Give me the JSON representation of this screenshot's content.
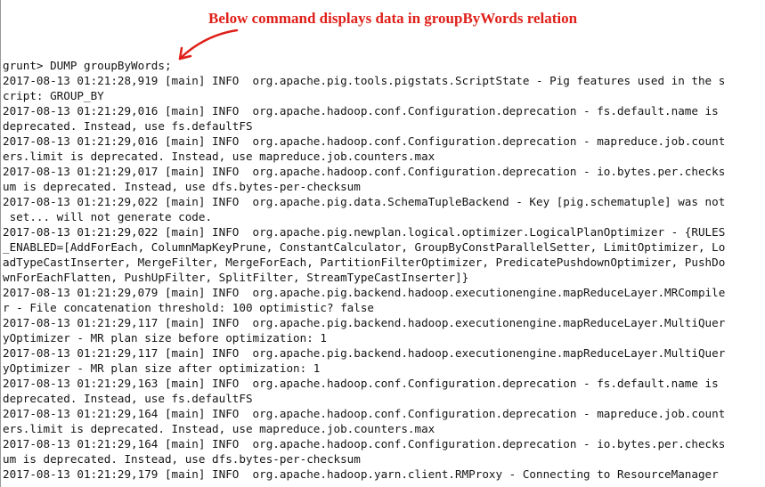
{
  "annotation": {
    "text": "Below command displays data in groupByWords relation",
    "color": "#e0201a",
    "arrow_icon": "curved-arrow-icon"
  },
  "terminal": {
    "lines": [
      "grunt> DUMP groupByWords;",
      "2017-08-13 01:21:28,919 [main] INFO  org.apache.pig.tools.pigstats.ScriptState - Pig features used in the s",
      "cript: GROUP_BY",
      "2017-08-13 01:21:29,016 [main] INFO  org.apache.hadoop.conf.Configuration.deprecation - fs.default.name is",
      "deprecated. Instead, use fs.defaultFS",
      "2017-08-13 01:21:29,016 [main] INFO  org.apache.hadoop.conf.Configuration.deprecation - mapreduce.job.count",
      "ers.limit is deprecated. Instead, use mapreduce.job.counters.max",
      "2017-08-13 01:21:29,017 [main] INFO  org.apache.hadoop.conf.Configuration.deprecation - io.bytes.per.checks",
      "um is deprecated. Instead, use dfs.bytes-per-checksum",
      "2017-08-13 01:21:29,022 [main] INFO  org.apache.pig.data.SchemaTupleBackend - Key [pig.schematuple] was not",
      " set... will not generate code.",
      "2017-08-13 01:21:29,022 [main] INFO  org.apache.pig.newplan.logical.optimizer.LogicalPlanOptimizer - {RULES",
      "_ENABLED=[AddForEach, ColumnMapKeyPrune, ConstantCalculator, GroupByConstParallelSetter, LimitOptimizer, Lo",
      "adTypeCastInserter, MergeFilter, MergeForEach, PartitionFilterOptimizer, PredicatePushdownOptimizer, PushDo",
      "wnForEachFlatten, PushUpFilter, SplitFilter, StreamTypeCastInserter]}",
      "2017-08-13 01:21:29,079 [main] INFO  org.apache.pig.backend.hadoop.executionengine.mapReduceLayer.MRCompile",
      "r - File concatenation threshold: 100 optimistic? false",
      "2017-08-13 01:21:29,117 [main] INFO  org.apache.pig.backend.hadoop.executionengine.mapReduceLayer.MultiQuer",
      "yOptimizer - MR plan size before optimization: 1",
      "2017-08-13 01:21:29,117 [main] INFO  org.apache.pig.backend.hadoop.executionengine.mapReduceLayer.MultiQuer",
      "yOptimizer - MR plan size after optimization: 1",
      "2017-08-13 01:21:29,163 [main] INFO  org.apache.hadoop.conf.Configuration.deprecation - fs.default.name is",
      "deprecated. Instead, use fs.defaultFS",
      "2017-08-13 01:21:29,164 [main] INFO  org.apache.hadoop.conf.Configuration.deprecation - mapreduce.job.count",
      "ers.limit is deprecated. Instead, use mapreduce.job.counters.max",
      "2017-08-13 01:21:29,164 [main] INFO  org.apache.hadoop.conf.Configuration.deprecation - io.bytes.per.checks",
      "um is deprecated. Instead, use dfs.bytes-per-checksum",
      "2017-08-13 01:21:29,179 [main] INFO  org.apache.hadoop.yarn.client.RMProxy - Connecting to ResourceManager"
    ]
  }
}
